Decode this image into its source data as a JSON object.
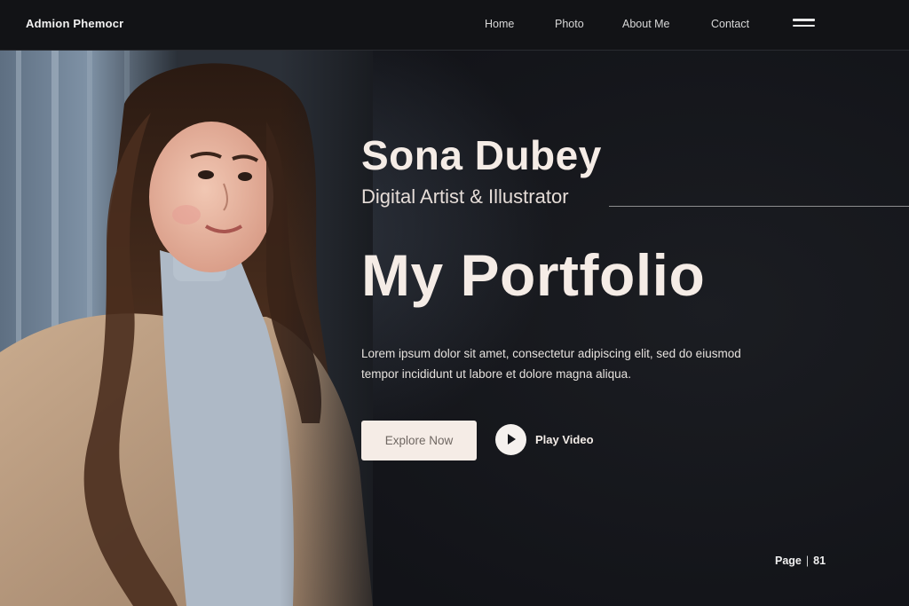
{
  "brand": "Admion Phemocr",
  "nav": {
    "items": [
      {
        "label": "Home"
      },
      {
        "label": "Photo"
      },
      {
        "label": "About Me"
      },
      {
        "label": "Contact"
      }
    ],
    "menu_icon": "hamburger-menu-icon"
  },
  "hero": {
    "name": "Sona Dubey",
    "role": "Digital Artist & Illustrator",
    "headline": "My Portfolio",
    "description": "Lorem ipsum dolor sit amet, consectetur adipiscing elit, sed do eiusmod tempor incididunt ut labore et dolore magna aliqua.",
    "primary_button": "Explore Now",
    "video_button": "Play Video",
    "video_icon": "play-icon"
  },
  "pager": {
    "label": "Page",
    "number": "81"
  },
  "colors": {
    "background": "#15171b",
    "accent_light": "#f5ece6",
    "button_text": "#6f6762"
  }
}
